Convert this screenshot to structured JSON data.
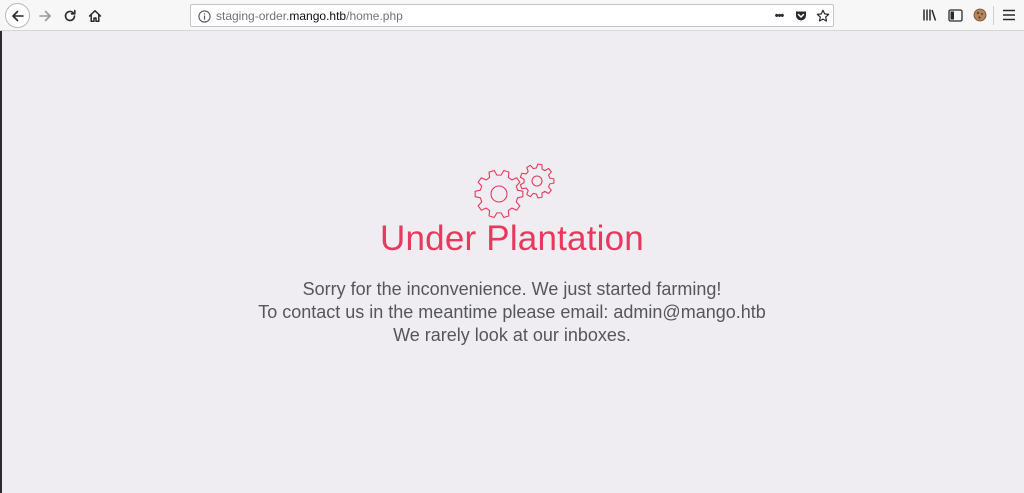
{
  "browser": {
    "url_prefix": "staging-order.",
    "url_domain": "mango.htb",
    "url_path": "/home.php",
    "more_actions_label": "•••"
  },
  "page": {
    "title": "Under Plantation",
    "line1": "Sorry for the inconvenience. We just started farming!",
    "line2": "To contact us in the meantime please email: admin@mango.htb",
    "line3": "We rarely look at our inboxes."
  },
  "colors": {
    "accent": "#e8385d",
    "text": "#55565c",
    "background": "#efedf2"
  },
  "icons": [
    "back-icon",
    "forward-icon",
    "reload-icon",
    "home-icon",
    "info-icon",
    "more-icon",
    "pocket-icon",
    "bookmark-star-icon",
    "library-icon",
    "sidebar-icon",
    "cookie-icon",
    "menu-icon",
    "gears-icon"
  ]
}
